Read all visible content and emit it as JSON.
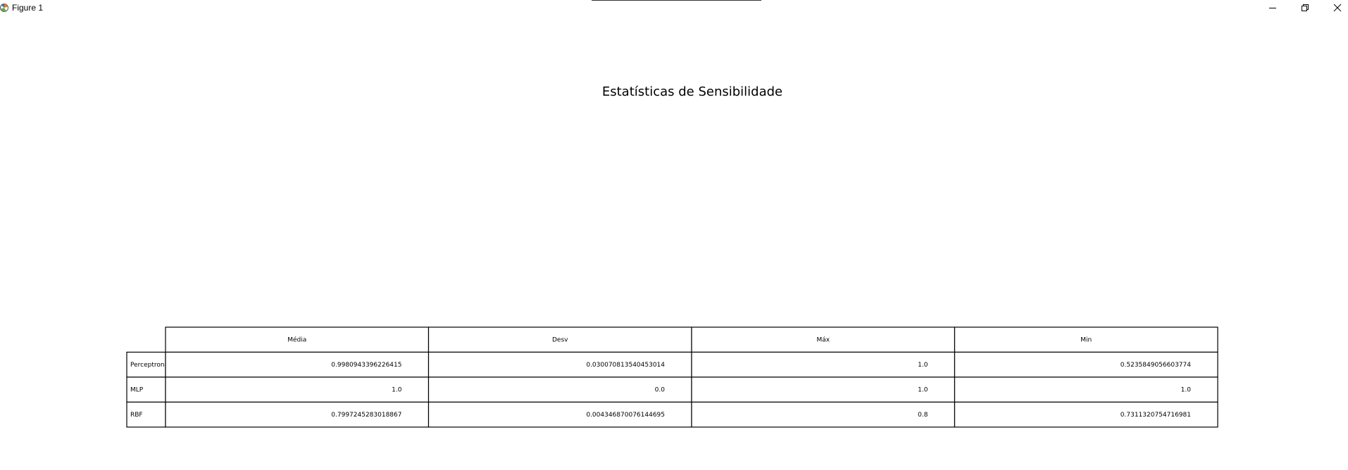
{
  "window": {
    "title": "Figure 1",
    "controls": {
      "minimize": "minimize-icon",
      "restore": "restore-icon",
      "close": "close-icon"
    }
  },
  "chart_data": {
    "type": "table",
    "title": "Estatísticas de Sensibilidade",
    "columns": [
      "Média",
      "Desv",
      "Máx",
      "Min"
    ],
    "rows": [
      {
        "label": "Perceptron",
        "values": [
          "0.9980943396226415",
          "0.030070813540453014",
          "1.0",
          "0.5235849056603774"
        ]
      },
      {
        "label": "MLP",
        "values": [
          "1.0",
          "0.0",
          "1.0",
          "1.0"
        ]
      },
      {
        "label": "RBF",
        "values": [
          "0.7997245283018867",
          "0.004346870076144695",
          "0.8",
          "0.7311320754716981"
        ]
      }
    ]
  }
}
